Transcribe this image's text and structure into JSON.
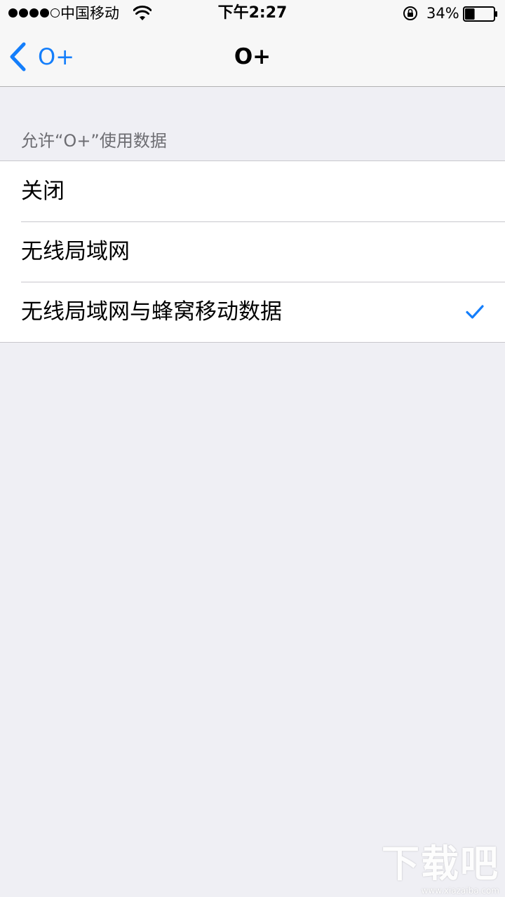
{
  "status_bar": {
    "signal_dots_filled": 4,
    "signal_dots_total": 5,
    "carrier": "中国移动",
    "time": "下午2:27",
    "battery_percent": "34%",
    "battery_level": 0.34
  },
  "nav": {
    "back_label": "O+",
    "title": "O+"
  },
  "section": {
    "header": "允许“O+”使用数据",
    "options": [
      {
        "label": "关闭",
        "selected": false
      },
      {
        "label": "无线局域网",
        "selected": false
      },
      {
        "label": "无线局域网与蜂窝移动数据",
        "selected": true
      }
    ]
  },
  "watermark": {
    "logo_text": "下载吧",
    "url": "www.xiazaiba.com"
  },
  "colors": {
    "accent": "#147efb",
    "background": "#efeff4",
    "nav_background": "#f7f7f7",
    "separator": "#c8c7cc",
    "section_header": "#6d6d72"
  }
}
